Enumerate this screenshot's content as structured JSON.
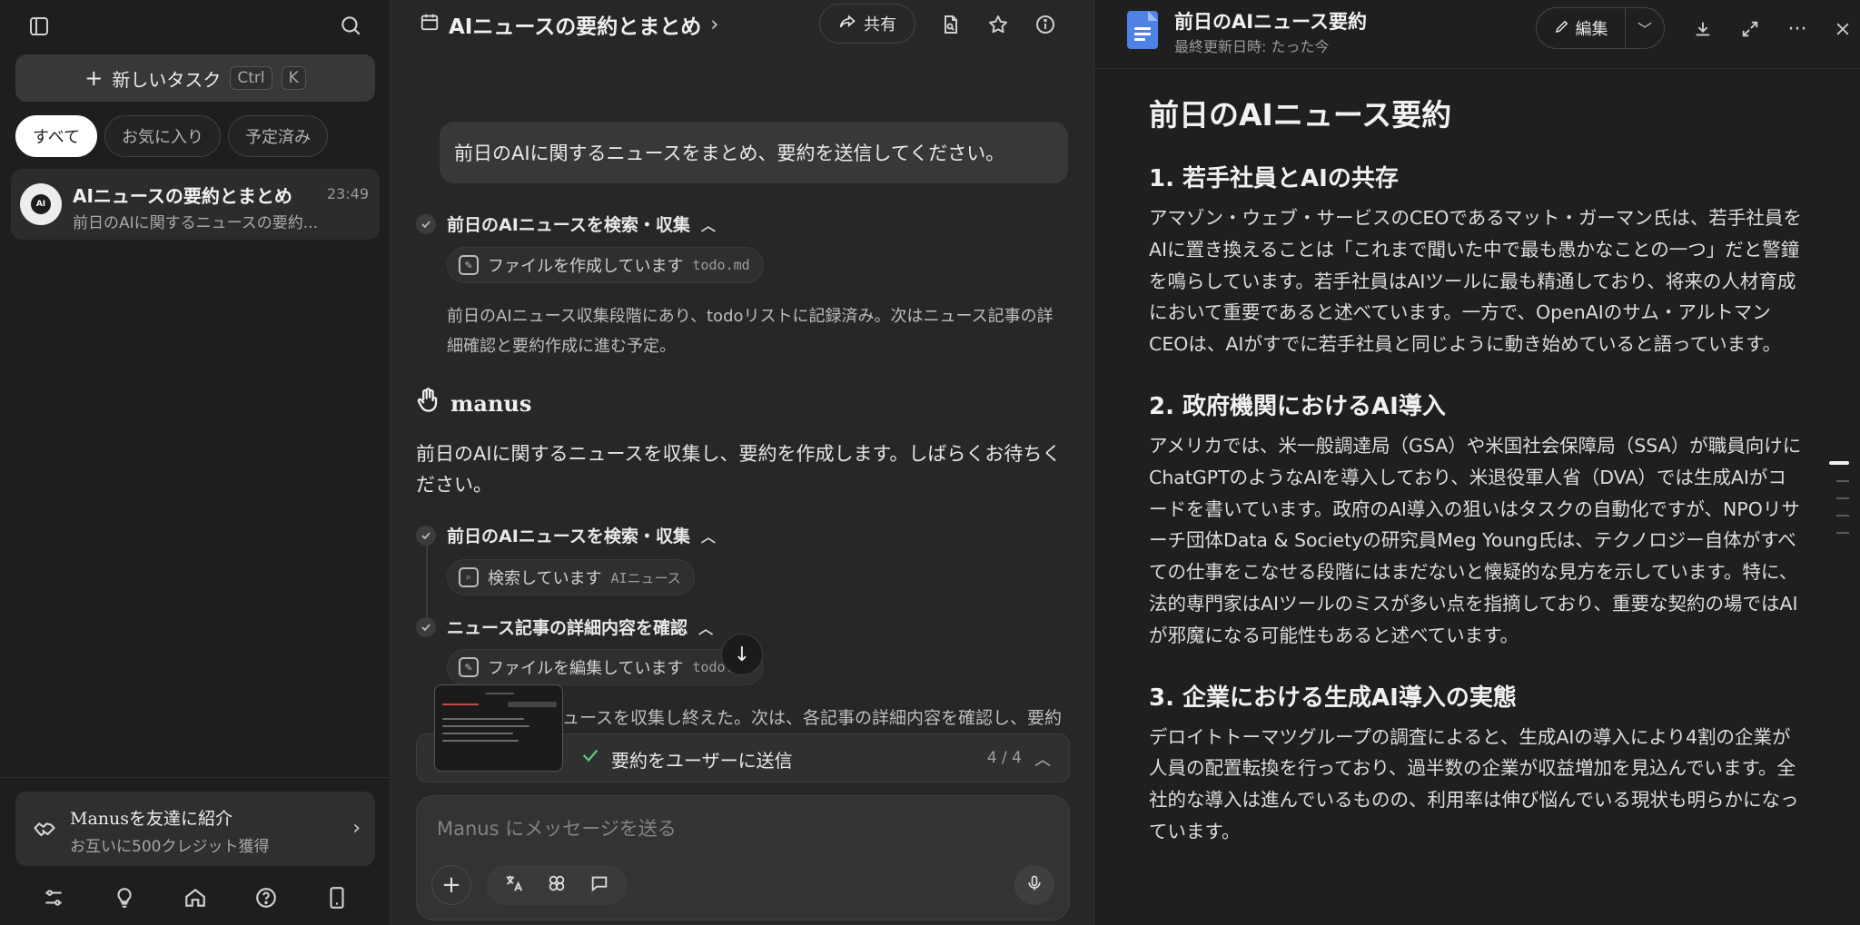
{
  "sidebar": {
    "new_task_label": "新しいタスク",
    "shortcut_ctrl": "Ctrl",
    "shortcut_k": "K",
    "filters": [
      {
        "label": "すべて",
        "active": true
      },
      {
        "label": "お気に入り",
        "active": false
      },
      {
        "label": "予定済み",
        "active": false
      }
    ],
    "task": {
      "avatar_text": "AI",
      "title": "AIニュースの要約とまとめ",
      "time": "23:49",
      "preview": "前日のAIに関するニュースの要約..."
    },
    "referral": {
      "title": "Manusを友達に紹介",
      "subtitle": "お互いに500クレジット獲得"
    },
    "bottom_icons": [
      "settings-sliders-icon",
      "lightbulb-icon",
      "home-icon",
      "help-icon",
      "mobile-icon"
    ]
  },
  "chat": {
    "title": "AIニュースの要約とまとめ",
    "share_label": "共有",
    "user_message": "前日のAIに関するニュースをまとめ、要約を送信してください。",
    "step1": {
      "title": "前日のAIニュースを検索・収集",
      "tool_label": "ファイルを作成しています",
      "tool_arg": "todo.md",
      "note": "前日のAIニュース収集段階にあり、todoリストに記録済み。次はニュース記事の詳細確認と要約作成に進む予定。"
    },
    "brand": "manus",
    "assistant_message": "前日のAIに関するニュースを収集し、要約を作成します。しばらくお待ちください。",
    "step2": {
      "title": "前日のAIニュースを検索・収集",
      "tool_label": "検索しています",
      "tool_arg": "AIニュース"
    },
    "step3": {
      "title": "ニュース記事の詳細内容を確認",
      "tool_label": "ファイルを編集しています",
      "tool_arg": "todo.md"
    },
    "partial_note": "ニュースを収集し終えた。次は、各記事の詳細内容を確認し、要約",
    "progress": {
      "label": "要約をユーザーに送信",
      "count": "4 / 4"
    },
    "composer_placeholder": "Manus にメッセージを送る"
  },
  "doc": {
    "name": "前日のAIニュース要約",
    "updated": "最終更新日時: たった今",
    "edit_label": "編集",
    "heading": "前日のAIニュース要約",
    "sections": [
      {
        "title": "1. 若手社員とAIの共存",
        "body": "アマゾン・ウェブ・サービスのCEOであるマット・ガーマン氏は、若手社員をAIに置き換えることは「これまで聞いた中で最も愚かなことの一つ」だと警鐘を鳴らしています。若手社員はAIツールに最も精通しており、将来の人材育成において重要であると述べています。一方で、OpenAIのサム・アルトマンCEOは、AIがすでに若手社員と同じように動き始めていると語っています。"
      },
      {
        "title": "2. 政府機関におけるAI導入",
        "body": "アメリカでは、米一般調達局（GSA）や米国社会保障局（SSA）が職員向けにChatGPTのようなAIを導入しており、米退役軍人省（DVA）では生成AIがコードを書いています。政府のAI導入の狙いはタスクの自動化ですが、NPOリサーチ団体Data & Societyの研究員Meg Young氏は、テクノロジー自体がすべての仕事をこなせる段階にはまだないと懐疑的な見方を示しています。特に、法的専門家はAIツールのミスが多い点を指摘しており、重要な契約の場ではAIが邪魔になる可能性もあると述べています。"
      },
      {
        "title": "3. 企業における生成AI導入の実態",
        "body": "デロイトトーマツグループの調査によると、生成AIの導入により4割の企業が人員の配置転換を行っており、過半数の企業が収益増加を見込んでいます。全社的な導入は進んでいるものの、利用率は伸び悩んでいる現状も明らかになっています。"
      }
    ]
  }
}
